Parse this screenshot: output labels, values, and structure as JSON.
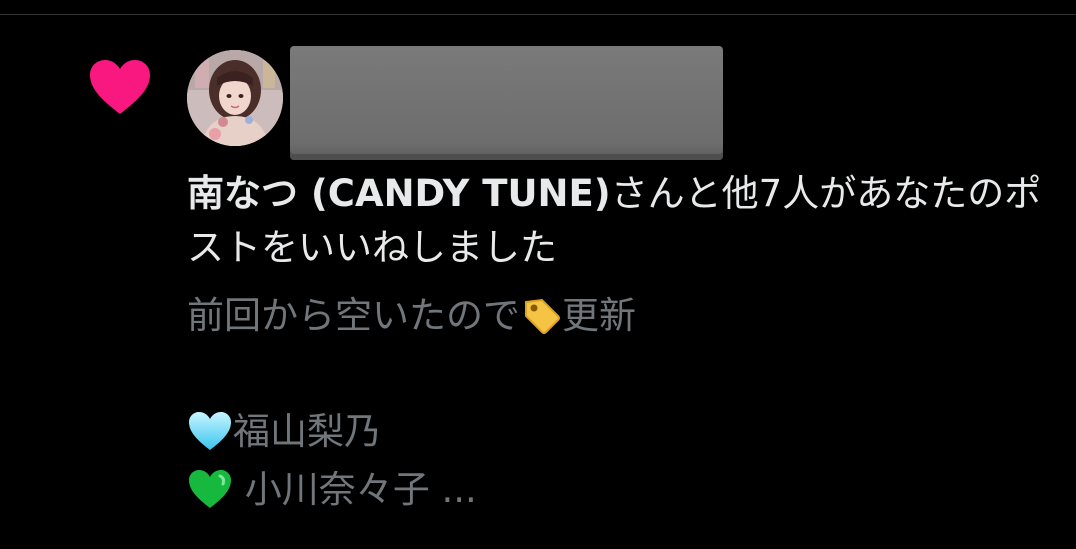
{
  "notification": {
    "liker_name": "南なつ (CANDY TUNE)",
    "action_text": "さんと他7人があなたのポストをいいねしました",
    "icon": "heart-icon",
    "accent_color": "#f91880"
  },
  "post_preview": {
    "line1_before": "前回から空いたので",
    "line1_emoji": "label-tag-emoji",
    "line1_after": "更新",
    "line2": "",
    "line3_emoji": "light-blue-heart-emoji",
    "line3_text": "福山梨乃",
    "line4_emoji": "green-heart-emoji",
    "line4_text": " 小川奈々子 ..."
  }
}
